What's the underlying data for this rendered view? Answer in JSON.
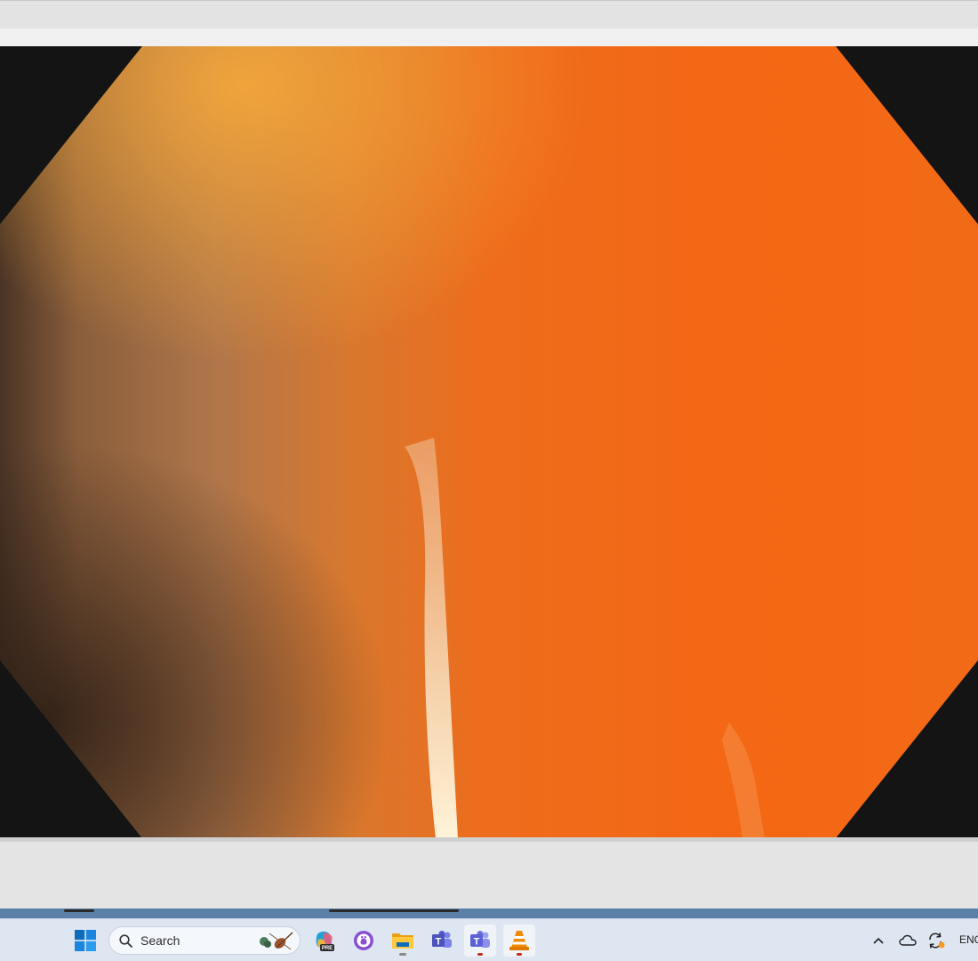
{
  "window": {
    "media_content": "video-frame"
  },
  "taskbar": {
    "search_label": "Search",
    "apps": [
      {
        "name": "start",
        "icon": "windows-logo-icon"
      },
      {
        "name": "copilot",
        "icon": "copilot-pre-icon",
        "badge": "PRE"
      },
      {
        "name": "github-desktop",
        "icon": "github-icon"
      },
      {
        "name": "file-explorer",
        "icon": "folder-icon"
      },
      {
        "name": "teams-classic",
        "icon": "teams-icon"
      },
      {
        "name": "teams",
        "icon": "teams-new-icon"
      },
      {
        "name": "vlc",
        "icon": "vlc-cone-icon"
      }
    ],
    "tray": {
      "language": "ENG"
    }
  },
  "colors": {
    "video_orange": "#f36a16",
    "taskbar_bg": "#dde6f1",
    "accent_blue": "#0f6cbd"
  }
}
